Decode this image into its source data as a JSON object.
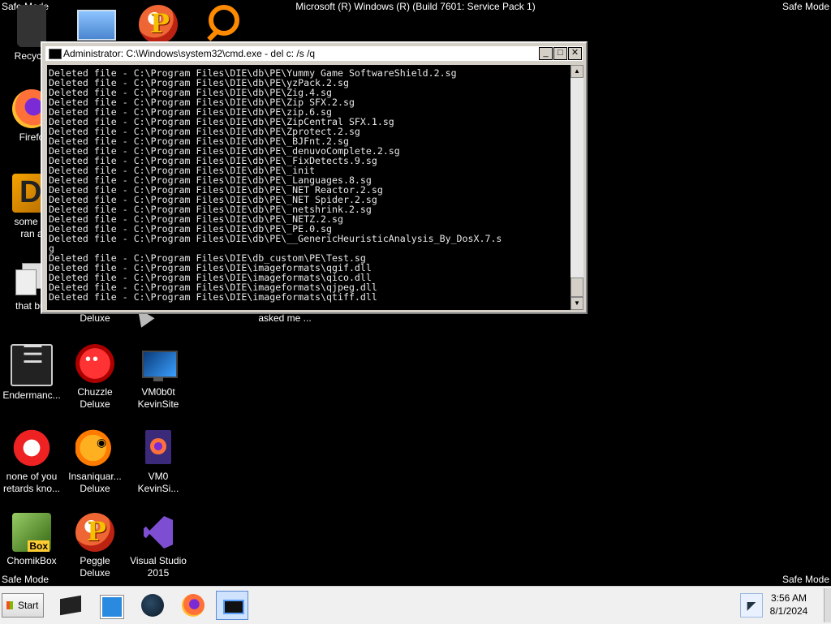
{
  "overlay": {
    "safe_mode_tl": "Safe Mode",
    "safe_mode_tr": "Safe Mode",
    "safe_mode_bl": "Safe Mode",
    "safe_mode_br": "Safe Mode",
    "build": "Microsoft (R) Windows (R) (Build 7601: Service Pack 1)"
  },
  "desktop_icons": [
    {
      "label": "Recycle",
      "icon": "recycle-bin-icon"
    },
    {
      "label": "",
      "icon": "mail-icon"
    },
    {
      "label": "",
      "icon": "peggle-icon"
    },
    {
      "label": "",
      "icon": "magnifier-icon"
    },
    {
      "label": "Firefo",
      "icon": "firefox-icon"
    },
    {
      "label": "some ru\nran a",
      "icon": "dosbox-icon"
    },
    {
      "label": "that but",
      "icon": "copy-icon"
    },
    {
      "label": "Deluxe",
      "icon": ""
    },
    {
      "label": "asked me ...",
      "icon": ""
    },
    {
      "label": "Endermanc...",
      "icon": "terminal-icon"
    },
    {
      "label": "Chuzzle\nDeluxe",
      "icon": "chuzzle-icon"
    },
    {
      "label": "VM0b0t\nKevinSite",
      "icon": "monitor-icon"
    },
    {
      "label": "none of you\nretards kno...",
      "icon": "bird-icon"
    },
    {
      "label": "Insaniquar...\nDeluxe",
      "icon": "fish-icon"
    },
    {
      "label": "VM0\nKevinSi...",
      "icon": "firefox-file-icon"
    },
    {
      "label": "ChomikBox",
      "icon": "chomikbox-icon"
    },
    {
      "label": "Peggle Deluxe",
      "icon": "peggle-icon"
    },
    {
      "label": "Visual Studio\n2015",
      "icon": "visual-studio-icon"
    }
  ],
  "cmd_window": {
    "title": "Administrator: C:\\Windows\\system32\\cmd.exe - del  c: /s /q",
    "minimize": "_",
    "maximize": "□",
    "close": "✕",
    "lines": [
      "Deleted file - C:\\Program Files\\DIE\\db\\PE\\Yummy Game SoftwareShield.2.sg",
      "Deleted file - C:\\Program Files\\DIE\\db\\PE\\yzPack.2.sg",
      "Deleted file - C:\\Program Files\\DIE\\db\\PE\\Zig.4.sg",
      "Deleted file - C:\\Program Files\\DIE\\db\\PE\\Zip SFX.2.sg",
      "Deleted file - C:\\Program Files\\DIE\\db\\PE\\zip.6.sg",
      "Deleted file - C:\\Program Files\\DIE\\db\\PE\\ZipCentral SFX.1.sg",
      "Deleted file - C:\\Program Files\\DIE\\db\\PE\\Zprotect.2.sg",
      "Deleted file - C:\\Program Files\\DIE\\db\\PE\\_BJFnt.2.sg",
      "Deleted file - C:\\Program Files\\DIE\\db\\PE\\_denuvoComplete.2.sg",
      "Deleted file - C:\\Program Files\\DIE\\db\\PE\\_FixDetects.9.sg",
      "Deleted file - C:\\Program Files\\DIE\\db\\PE\\_init",
      "Deleted file - C:\\Program Files\\DIE\\db\\PE\\_Languages.8.sg",
      "Deleted file - C:\\Program Files\\DIE\\db\\PE\\_NET Reactor.2.sg",
      "Deleted file - C:\\Program Files\\DIE\\db\\PE\\_NET Spider.2.sg",
      "Deleted file - C:\\Program Files\\DIE\\db\\PE\\_netshrink.2.sg",
      "Deleted file - C:\\Program Files\\DIE\\db\\PE\\_NETZ.2.sg",
      "Deleted file - C:\\Program Files\\DIE\\db\\PE\\_PE.0.sg",
      "Deleted file - C:\\Program Files\\DIE\\db\\PE\\__GenericHeuristicAnalysis_By_DosX.7.s",
      "g",
      "Deleted file - C:\\Program Files\\DIE\\db_custom\\PE\\Test.sg",
      "Deleted file - C:\\Program Files\\DIE\\imageformats\\qgif.dll",
      "Deleted file - C:\\Program Files\\DIE\\imageformats\\qico.dll",
      "Deleted file - C:\\Program Files\\DIE\\imageformats\\qjpeg.dll",
      "Deleted file - C:\\Program Files\\DIE\\imageformats\\qtiff.dll"
    ]
  },
  "taskbar": {
    "start_label": "Start",
    "items": [
      "terminal-icon",
      "media-player-icon",
      "globe-icon",
      "firefox-icon",
      "cmd-icon"
    ],
    "clock_time": "3:56 AM",
    "clock_date": "8/1/2024"
  }
}
